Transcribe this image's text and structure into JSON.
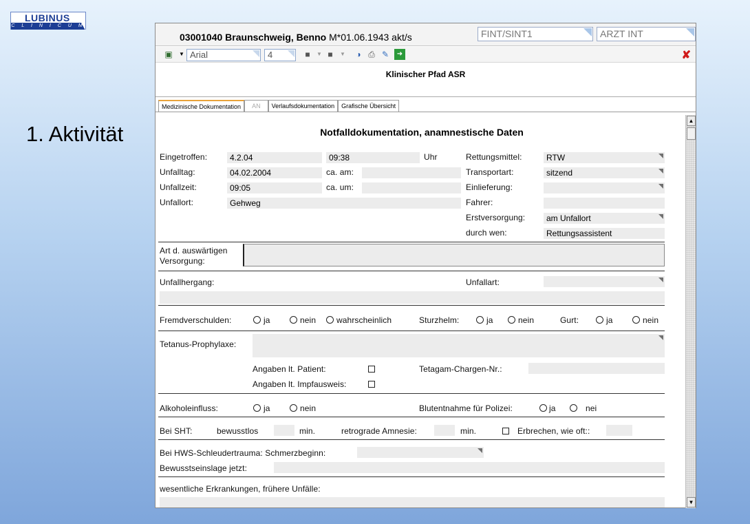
{
  "logo": {
    "brand": "LUBINUS",
    "sub": "C L I N I C U M"
  },
  "slide": {
    "heading": "1. Aktivität"
  },
  "patient": {
    "id_name": "03001040 Braunschweig, Benno",
    "birth": "M*01.06.1943 akt/s"
  },
  "header_fields": {
    "station": "FINT/SINT1",
    "role": "ARZT INT"
  },
  "toolbar": {
    "font": "Arial",
    "size": "4"
  },
  "pathway_title": "Klinischer Pfad ASR",
  "tabs": [
    "Medizinische Dokumentation",
    "AN",
    "Verlaufsdokumentation",
    "Grafische Übersicht"
  ],
  "form": {
    "title": "Notfalldokumentation, anamnestische Daten",
    "eingetroffen_label": "Eingetroffen:",
    "eingetroffen": "4.2.04",
    "eingetroffen_time": "09:38",
    "uhr": "Uhr",
    "unfalltag_label": "Unfalltag:",
    "unfalltag": "04.02.2004",
    "ca_am": "ca. am:",
    "unfallzeit_label": "Unfallzeit:",
    "unfallzeit": "09:05",
    "ca_um": "ca. um:",
    "unfallort_label": "Unfallort:",
    "unfallort": "Gehweg",
    "rettungsmittel_label": "Rettungsmittel:",
    "rettungsmittel": "RTW",
    "transportart_label": "Transportart:",
    "transportart": "sitzend",
    "einlieferung_label": "Einlieferung:",
    "einlieferung": "",
    "fahrer_label": "Fahrer:",
    "fahrer": "",
    "erstversorgung_label": "Erstversorgung:",
    "erstversorgung": "am Unfallort",
    "durch_wen_label": "durch wen:",
    "durch_wen": "Rettungsassistent",
    "art_versorgung_label_1": "Art d. auswärtigen",
    "art_versorgung_label_2": "Versorgung:",
    "unfallhergang_label": "Unfallhergang:",
    "unfallart_label": "Unfallart:",
    "fremdverschulden_label": "Fremdverschulden:",
    "opt_ja": "ja",
    "opt_nein": "nein",
    "opt_wahrscheinlich": "wahrscheinlich",
    "sturzhelm_label": "Sturzhelm:",
    "gurt_label": "Gurt:",
    "tetanus_label": "Tetanus-Prophylaxe:",
    "angaben_patient": "Angaben lt. Patient:",
    "angaben_impfausweis": "Angaben lt. Impfausweis:",
    "tetagam_label": "Tetagam-Chargen-Nr.:",
    "alkohol_label": "Alkoholeinfluss:",
    "blutentnahme_label": "Blutentnahme für Polizei:",
    "opt_nei": "nei",
    "sht_label": "Bei SHT:",
    "bewusstlos": "bewusstlos",
    "min": "min.",
    "amnesie": "retrograde Amnesie:",
    "erbrechen": "Erbrechen, wie oft::",
    "hws_label": "Bei HWS-Schleudertrauma: Schmerzbeginn:",
    "bewusstseinslage_label": "Bewusstseinslage jetzt:",
    "erkrankungen_label": "wesentliche Erkrankungen, frühere Unfälle:"
  }
}
